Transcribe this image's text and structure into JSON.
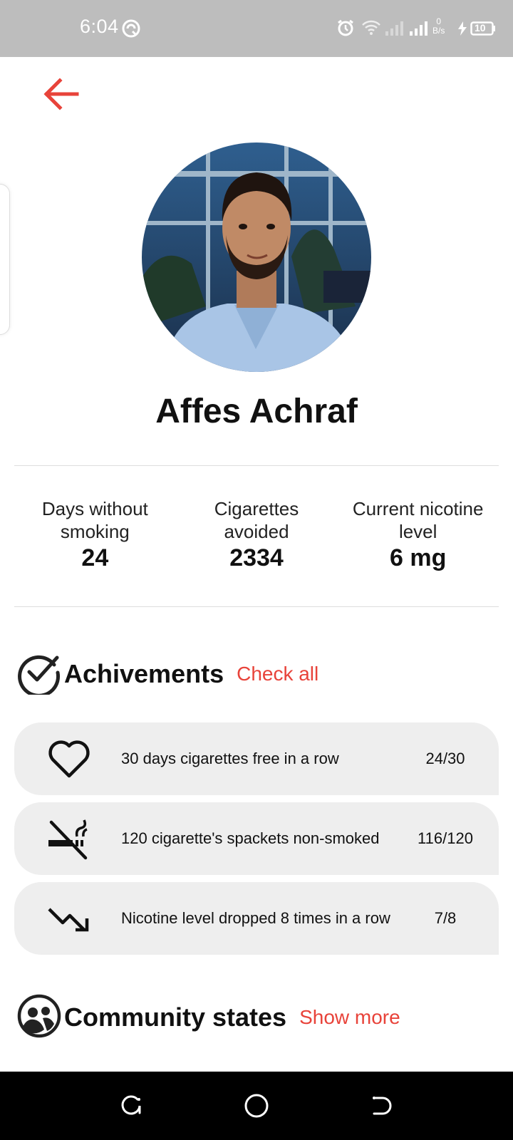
{
  "status_bar": {
    "time": "6:04",
    "net_speed_value": "0",
    "net_speed_unit": "B/s",
    "battery": "10",
    "icons": [
      "sync-icon",
      "alarm-icon",
      "wifi-icon",
      "signal-icon",
      "signal-icon",
      "charging-icon",
      "battery-icon"
    ]
  },
  "header": {
    "back_icon": "arrow-left-icon"
  },
  "profile": {
    "name": "Affes Achraf"
  },
  "stats": [
    {
      "label_line1": "Days without",
      "label_line2": "smoking",
      "value": "24"
    },
    {
      "label_line1": "Cigarettes",
      "label_line2": "avoided",
      "value": "2334"
    },
    {
      "label_line1": "Current nicotine",
      "label_line2": "level",
      "value": "6 mg"
    }
  ],
  "achievements": {
    "title": "Achivements",
    "link": "Check all",
    "items": [
      {
        "icon": "heart-icon",
        "text": "30 days cigarettes free in a row",
        "progress": "24/30"
      },
      {
        "icon": "no-smoking-icon",
        "text": "120 cigarette's spackets non-smoked",
        "progress": "116/120"
      },
      {
        "icon": "trending-down-icon",
        "text": "Nicotine level dropped 8 times in a row",
        "progress": "7/8"
      }
    ]
  },
  "community": {
    "title": "Community states",
    "link": "Show more"
  },
  "colors": {
    "accent": "#e8433a",
    "card_bg": "#eeeeee",
    "status_bar": "#bdbdbd"
  }
}
